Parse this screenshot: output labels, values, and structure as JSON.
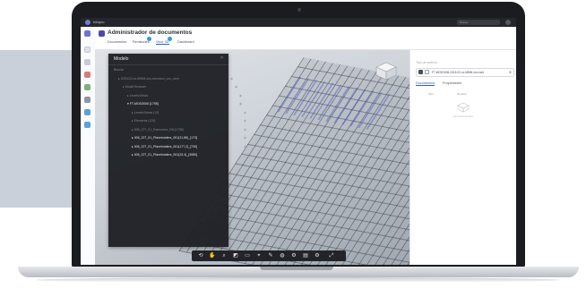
{
  "app": {
    "brand": "Infopro",
    "page_title": "Administrador de documentos",
    "search_placeholder": "Buscar",
    "tabs": [
      {
        "label": "Documentos",
        "active": false
      },
      {
        "label": "Revisiones",
        "active": false,
        "badge": true
      },
      {
        "label": "Visor 3D",
        "active": true,
        "badge": true
      },
      {
        "label": "Dashboard",
        "active": false
      }
    ]
  },
  "model_panel": {
    "title": "Modelo",
    "close": "×",
    "rows": [
      {
        "label": "Buscar",
        "indent": 0,
        "bright": false
      },
      {
        "label": "▸ 2015-02-xx-MMM-xxx-xxxxxxxx_xxx_xxxx",
        "indent": 1,
        "bright": false
      },
      {
        "label": "▸ Model Browser",
        "indent": 2,
        "bright": false
      },
      {
        "label": "▸ Levels/Views",
        "indent": 3,
        "bright": false
      },
      {
        "label": "▾ FT-MOD3006 [1798]",
        "indent": 3,
        "bright": true
      },
      {
        "label": "▸ Levels/Views (12)",
        "indent": 4,
        "bright": false
      },
      {
        "label": "▸ Elements (120)",
        "indent": 4,
        "bright": false
      },
      {
        "label": "▸ 006_227_01_Estructura_001(1798)",
        "indent": 4,
        "bright": false
      },
      {
        "label": "▸ 006_227_01_Placeholders_001(21,86)_[173]",
        "indent": 4,
        "bright": true
      },
      {
        "label": "▸ 006_227_01_Placeholders_001(177,2)_[730]",
        "indent": 4,
        "bright": true
      },
      {
        "label": "▸ 006_227_01_Placeholders_001(23,4)_[3980]",
        "indent": 4,
        "bright": true
      }
    ],
    "eye_icon": "◉"
  },
  "right_panel": {
    "label": "Tipo de archivo",
    "file_name": "FT-MOD3006-2015-02-xx-MMM-xxx.nwd",
    "tabs": [
      {
        "label": "Documentos",
        "active": true
      },
      {
        "label": "Propiedades",
        "active": false
      }
    ],
    "columns": [
      "Tipo",
      "Nombre"
    ],
    "empty_text": "Sin documentos"
  },
  "toolbar": {
    "tools": [
      "⟲",
      "✋",
      "⌕",
      "◩",
      "▭",
      "⌖",
      "✎",
      "◍",
      "⚙",
      "▤",
      "⚙",
      "⤢"
    ]
  },
  "colors": {
    "accent": "#2f5fc4",
    "brand": "#4f46a8",
    "panel_dark": "#1f2126"
  }
}
